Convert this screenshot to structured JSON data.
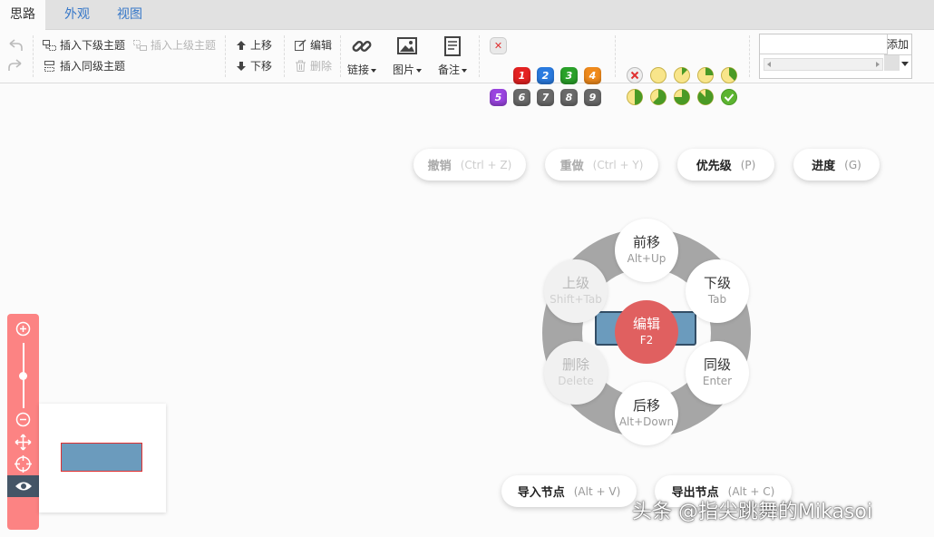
{
  "tabs": [
    "思路",
    "外观",
    "视图"
  ],
  "toolbar": {
    "insert_child": "插入下级主题",
    "insert_parent": "插入上级主题",
    "insert_sibling": "插入同级主题",
    "move_up": "上移",
    "move_down": "下移",
    "edit": "编辑",
    "delete": "删除",
    "link": "链接",
    "image": "图片",
    "note": "备注",
    "priorities": [
      "1",
      "2",
      "3",
      "4",
      "5",
      "6",
      "7",
      "8",
      "9"
    ],
    "priority_colors": [
      "#e52222",
      "#2a7be0",
      "#2aa22a",
      "#f08a1c",
      "#9a44e0",
      "#6a6a6a",
      "#6a6a6a",
      "#6a6a6a",
      "#6a6a6a"
    ],
    "progress_values": [
      0,
      0.125,
      0.25,
      0.375,
      0.5,
      0.625,
      0.75,
      0.875,
      1
    ],
    "add_label": "添加",
    "search_value": ""
  },
  "hotbox_top": [
    {
      "label": "撤销",
      "shortcut": "(Ctrl + Z)"
    },
    {
      "label": "重做",
      "shortcut": "(Ctrl + Y)"
    },
    {
      "label": "优先级",
      "shortcut": "(P)"
    },
    {
      "label": "进度",
      "shortcut": "(G)"
    }
  ],
  "ring": {
    "front": {
      "label": "前移",
      "hint": "Alt+Up"
    },
    "parent": {
      "label": "上级",
      "hint": "Shift+Tab"
    },
    "child": {
      "label": "下级",
      "hint": "Tab"
    },
    "edit": {
      "label": "编辑",
      "hint": "F2"
    },
    "delete": {
      "label": "删除",
      "hint": "Delete"
    },
    "sibling": {
      "label": "同级",
      "hint": "Enter"
    },
    "back": {
      "label": "后移",
      "hint": "Alt+Down"
    }
  },
  "hotbox_bottom": [
    {
      "label": "导入节点",
      "shortcut": "(Alt + V)"
    },
    {
      "label": "导出节点",
      "shortcut": "(Alt + C)"
    }
  ],
  "zoom_level": 0.5,
  "watermark": "头条 @指尖跳舞的Mikasoi",
  "colors": {
    "accent": "#3677c8",
    "nav": "#fc8383",
    "node": "#6b9bbd",
    "edit_center": "#e06060"
  }
}
